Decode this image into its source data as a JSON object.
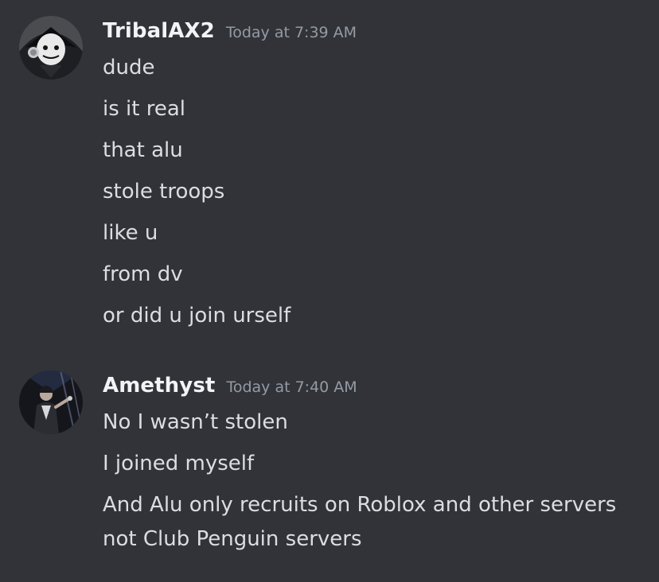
{
  "messages": [
    {
      "author": "TribalAX2",
      "timestamp": "Today at 7:39 AM",
      "avatar_icon": "masked-figure-avatar-icon",
      "lines": [
        "dude",
        "is it real",
        "that alu",
        "stole troops",
        "like u",
        "from dv",
        "or did u join urself"
      ]
    },
    {
      "author": "Amethyst",
      "timestamp": "Today at 7:40 AM",
      "avatar_icon": "performer-on-stage-avatar-icon",
      "lines": [
        "No I wasn’t stolen",
        "I joined myself",
        "And Alu only recruits on Roblox and other servers not Club Penguin servers"
      ]
    }
  ],
  "colors": {
    "background": "#313338",
    "username": "#f2f3f5",
    "timestamp": "#949ba4",
    "message_text": "#dbdee1"
  }
}
